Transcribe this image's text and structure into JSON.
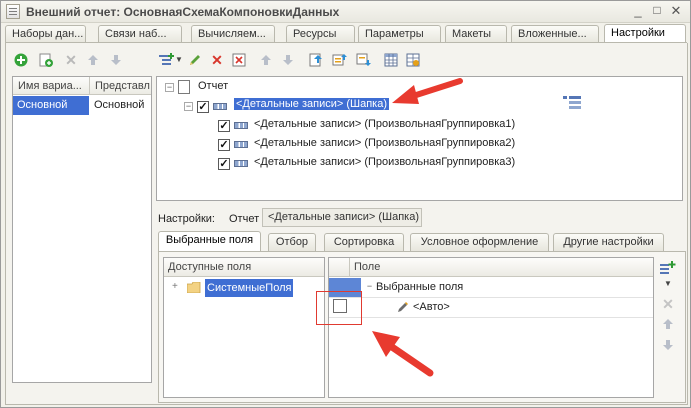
{
  "window": {
    "title": "Внешний отчет: ОсновнаяСхемаКомпоновкиДанных",
    "controls": {
      "minimize": "_",
      "maximize": "□",
      "close": "✕"
    }
  },
  "tabs": [
    {
      "label": "Наборы дан...",
      "active": false
    },
    {
      "label": "Связи наб...",
      "active": false
    },
    {
      "label": "Вычисляем...",
      "active": false
    },
    {
      "label": "Ресурсы",
      "active": false
    },
    {
      "label": "Параметры",
      "active": false
    },
    {
      "label": "Макеты",
      "active": false
    },
    {
      "label": "Вложенные...",
      "active": false
    },
    {
      "label": "Настройки",
      "active": true
    }
  ],
  "variants": {
    "columns": [
      "Имя вариа...",
      "Представл"
    ],
    "rows": [
      {
        "name": "Основной",
        "presentation": "Основной"
      }
    ]
  },
  "structure": {
    "root_label": "Отчет",
    "detail_header": "<Детальные записи> (Шапка)",
    "groups": [
      "<Детальные записи> (ПроизвольнаяГруппировка1)",
      "<Детальные записи> (ПроизвольнаяГруппировка2)",
      "<Детальные записи> (ПроизвольнаяГруппировка3)"
    ]
  },
  "settings": {
    "label": "Настройки:",
    "report_label": "Отчет",
    "current_value": "<Детальные записи> (Шапка)"
  },
  "settings_tabs": [
    {
      "label": "Выбранные поля",
      "active": true
    },
    {
      "label": "Отбор",
      "active": false
    },
    {
      "label": "Сортировка",
      "active": false
    },
    {
      "label": "Условное оформление",
      "active": false
    },
    {
      "label": "Другие настройки",
      "active": false
    }
  ],
  "available_fields": {
    "header": "Доступные поля",
    "items": [
      "СистемныеПоля"
    ]
  },
  "selected_fields": {
    "header": "Поле",
    "group_label": "Выбранные поля",
    "auto_label": "<Авто>"
  },
  "colors": {
    "selection": "#3f6ed3",
    "annotation_arrow": "#e83a2f",
    "annotation_box": "#e03a30"
  }
}
